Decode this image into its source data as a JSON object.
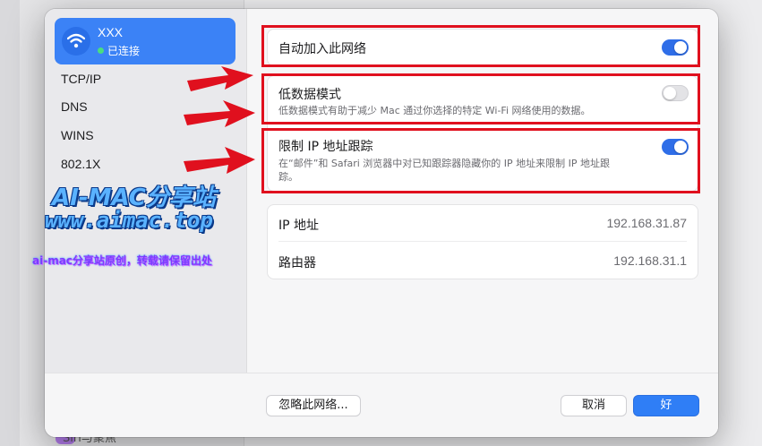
{
  "background": {
    "sidebar_bottom_text": "Siri与聚焦"
  },
  "sidebar": {
    "network": {
      "name": "XXX",
      "status": "已连接",
      "icon": "wifi-icon"
    },
    "items": [
      {
        "label": "TCP/IP"
      },
      {
        "label": "DNS"
      },
      {
        "label": "WINS"
      },
      {
        "label": "802.1X"
      }
    ]
  },
  "settings": {
    "auto_join": {
      "title": "自动加入此网络",
      "enabled": true
    },
    "low_data": {
      "title": "低数据模式",
      "description": "低数据模式有助于减少 Mac 通过你选择的特定 Wi-Fi 网络使用的数据。",
      "enabled": false
    },
    "limit_ip": {
      "title": "限制 IP 地址跟踪",
      "description": "在“邮件”和 Safari 浏览器中对已知跟踪器隐藏你的 IP 地址来限制 IP 地址跟踪。",
      "enabled": true
    }
  },
  "info": {
    "ip_label": "IP 地址",
    "ip_value": "192.168.31.87",
    "router_label": "路由器",
    "router_value": "192.168.31.1"
  },
  "footer": {
    "forget_label": "忽略此网络...",
    "cancel_label": "取消",
    "ok_label": "好"
  },
  "watermark": {
    "line1": "AI-MAC分享站",
    "line2": "www.aimac.top",
    "line3": "ai-mac分享站原创，转载请保留出处"
  },
  "colors": {
    "accent": "#2f7ef6",
    "highlight": "#e0101e",
    "selected_network": "#3b82f6"
  }
}
